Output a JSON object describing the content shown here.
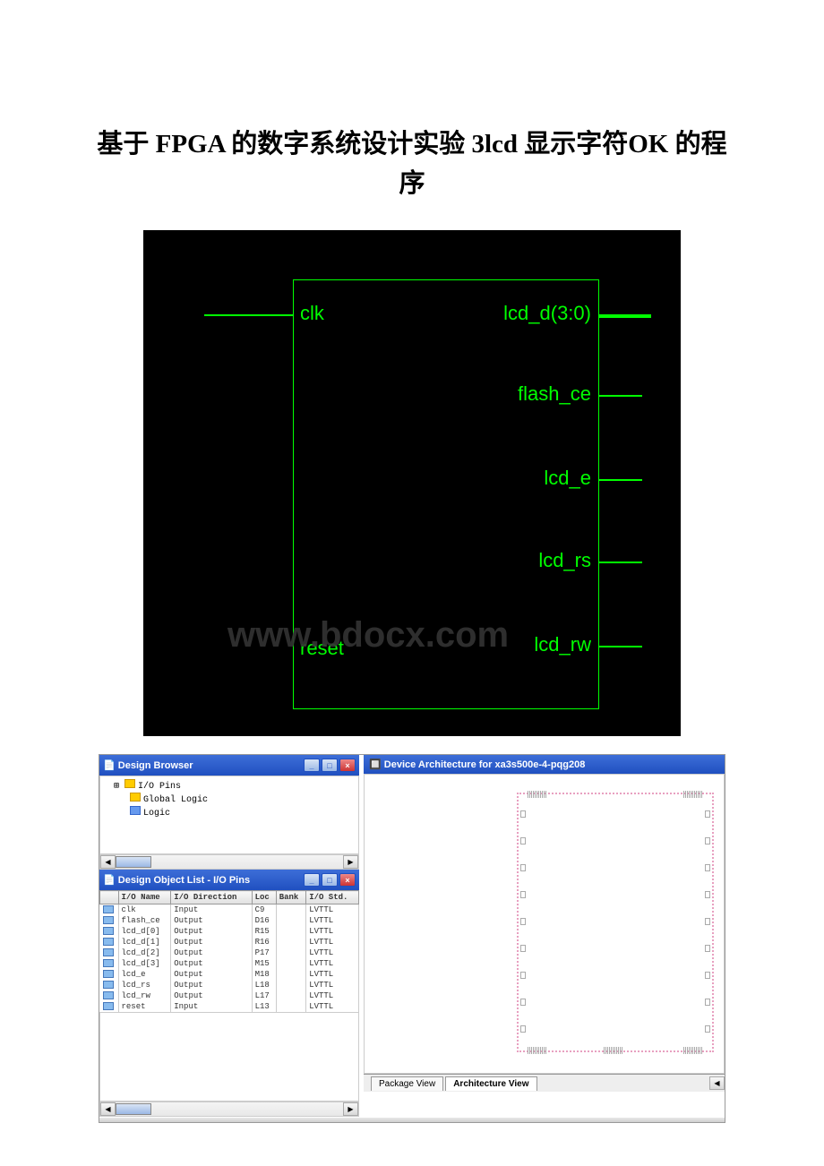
{
  "title": "基于 FPGA 的数字系统设计实验 3lcd 显示字符OK 的程序",
  "schematic": {
    "ports": {
      "clk": "clk",
      "reset": "reset",
      "lcd_d": "lcd_d(3:0)",
      "flash_ce": "flash_ce",
      "lcd_e": "lcd_e",
      "lcd_rs": "lcd_rs",
      "lcd_rw": "lcd_rw"
    }
  },
  "watermark": "www.bdocx.com",
  "browser_window": {
    "title": "Design Browser",
    "tree": {
      "io_pins": "I/O Pins",
      "global_logic": "Global Logic",
      "logic": "Logic"
    }
  },
  "object_list_window": {
    "title": "Design Object List - I/O Pins",
    "headers": {
      "icon": "",
      "name": "I/O Name",
      "direction": "I/O Direction",
      "loc": "Loc",
      "bank": "Bank",
      "std": "I/O Std."
    },
    "rows": [
      {
        "name": "clk",
        "dir": "Input",
        "loc": "C9",
        "bank": "",
        "std": "LVTTL"
      },
      {
        "name": "flash_ce",
        "dir": "Output",
        "loc": "D16",
        "bank": "",
        "std": "LVTTL"
      },
      {
        "name": "lcd_d[0]",
        "dir": "Output",
        "loc": "R15",
        "bank": "",
        "std": "LVTTL"
      },
      {
        "name": "lcd_d[1]",
        "dir": "Output",
        "loc": "R16",
        "bank": "",
        "std": "LVTTL"
      },
      {
        "name": "lcd_d[2]",
        "dir": "Output",
        "loc": "P17",
        "bank": "",
        "std": "LVTTL"
      },
      {
        "name": "lcd_d[3]",
        "dir": "Output",
        "loc": "M15",
        "bank": "",
        "std": "LVTTL"
      },
      {
        "name": "lcd_e",
        "dir": "Output",
        "loc": "M18",
        "bank": "",
        "std": "LVTTL"
      },
      {
        "name": "lcd_rs",
        "dir": "Output",
        "loc": "L18",
        "bank": "",
        "std": "LVTTL"
      },
      {
        "name": "lcd_rw",
        "dir": "Output",
        "loc": "L17",
        "bank": "",
        "std": "LVTTL"
      },
      {
        "name": "reset",
        "dir": "Input",
        "loc": "L13",
        "bank": "",
        "std": "LVTTL"
      }
    ]
  },
  "device_window": {
    "title": "Device Architecture for xa3s500e-4-pqg208",
    "tabs": {
      "package": "Package View",
      "architecture": "Architecture View"
    }
  }
}
